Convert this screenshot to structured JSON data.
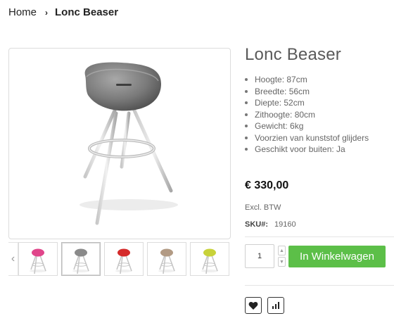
{
  "breadcrumb": {
    "home": "Home",
    "separator": "›",
    "current": "Lonc Beaser"
  },
  "product": {
    "title": "Lonc Beaser",
    "specs": [
      "Hoogte: 87cm",
      "Breedte: 56cm",
      "Diepte: 52cm",
      "Zithoogte: 80cm",
      "Gewicht: 6kg",
      "Voorzien van kunststof glijders",
      "Geschikt voor buiten: Ja"
    ],
    "price": "€ 330,00",
    "price_note": "Excl. BTW",
    "sku_label": "SKU#:",
    "sku_value": "19160"
  },
  "gallery": {
    "prev_label": "‹",
    "main_seat_color": "#7a7a7a",
    "thumbnails": [
      {
        "name": "thumb-pink",
        "color": "#e0458a"
      },
      {
        "name": "thumb-grey",
        "color": "#8a8a8a",
        "active": true
      },
      {
        "name": "thumb-red",
        "color": "#d42a2a"
      },
      {
        "name": "thumb-taupe",
        "color": "#b29a84"
      },
      {
        "name": "thumb-lime",
        "color": "#c8d23a"
      }
    ]
  },
  "cart": {
    "quantity": "1",
    "add_label": "In Winkelwagen",
    "button_color": "#5cbf48"
  },
  "actions": {
    "wishlist_icon": "heart-icon",
    "compare_icon": "bar-chart-icon"
  }
}
